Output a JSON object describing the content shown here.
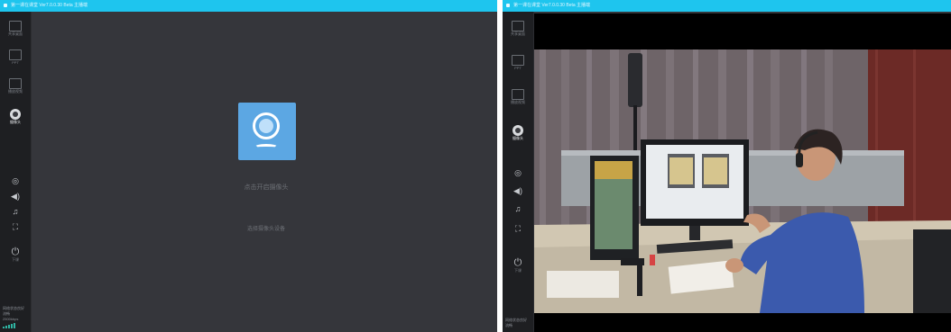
{
  "window_left": {
    "title": "第一课在课堂 Ver7.0.0.30 Beta 主播端",
    "sidebar": {
      "items": [
        {
          "label": "共享桌面",
          "icon": "screen-share-icon"
        },
        {
          "label": "PPT",
          "icon": "ppt-icon"
        },
        {
          "label": "播放视频",
          "icon": "video-play-icon"
        },
        {
          "label": "摄像头",
          "icon": "webcam-icon",
          "active": true
        }
      ],
      "tools": [
        {
          "glyph": "◎",
          "icon": "settings-icon"
        },
        {
          "glyph": "◀)",
          "icon": "volume-icon"
        },
        {
          "glyph": "♫",
          "icon": "music-icon"
        },
        {
          "glyph": "⛶",
          "icon": "fullscreen-icon"
        }
      ],
      "power": {
        "glyph": "⏻",
        "label": "下课",
        "icon": "power-icon"
      },
      "footer": [
        "网络状态良好",
        "流畅",
        "2500kbps"
      ]
    },
    "main": {
      "status_text": "点击开启摄像头",
      "hint_text": "选择摄像头设备"
    }
  },
  "window_right": {
    "title": "第一课在课堂 Ver7.0.0.30 Beta 主播端",
    "sidebar": {
      "items": [
        {
          "label": "共享桌面",
          "icon": "screen-share-icon"
        },
        {
          "label": "PPT",
          "icon": "ppt-icon"
        },
        {
          "label": "播放视频",
          "icon": "video-play-icon"
        },
        {
          "label": "摄像头",
          "icon": "webcam-icon",
          "active": true
        }
      ],
      "tools": [
        {
          "glyph": "◎",
          "icon": "settings-icon"
        },
        {
          "glyph": "◀)",
          "icon": "volume-icon"
        },
        {
          "glyph": "♫",
          "icon": "music-icon"
        },
        {
          "glyph": "⛶",
          "icon": "fullscreen-icon"
        }
      ],
      "power": {
        "glyph": "⏻",
        "label": "下课",
        "icon": "power-icon"
      },
      "footer": [
        "网络状态良好",
        "流畅",
        "2500kbps"
      ]
    }
  },
  "colors": {
    "title_bar": "#1ec5ee",
    "app_background": "#35363b",
    "sidebar_background": "#1e1f22",
    "webcam_tile": "#5ca7e3"
  }
}
